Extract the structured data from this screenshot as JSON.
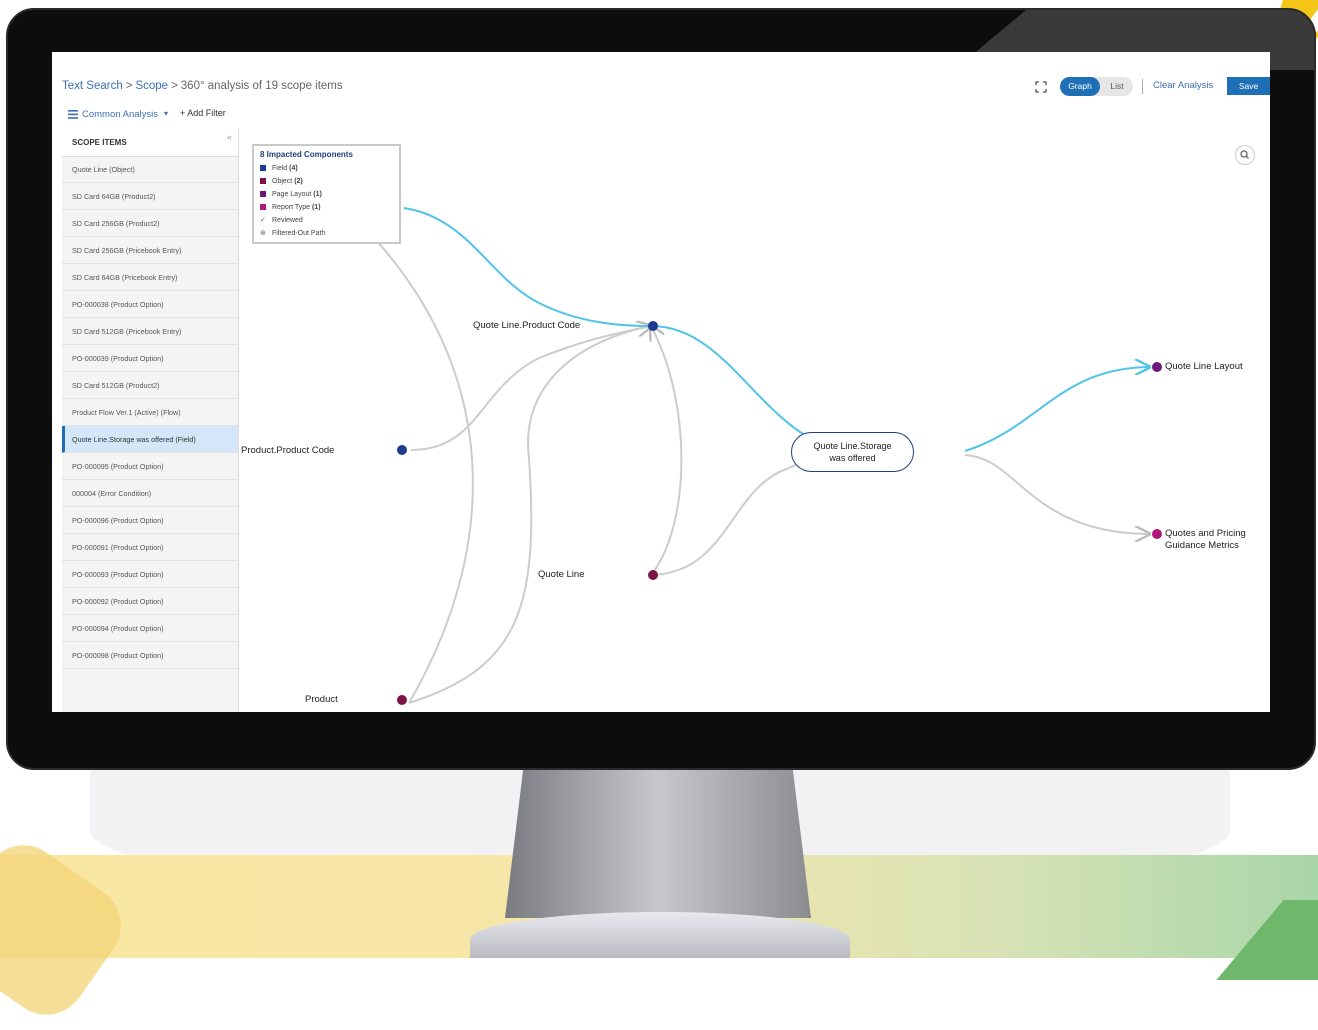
{
  "header": {
    "breadcrumb": [
      "Text Search",
      "Scope",
      "360° analysis of 19 scope items"
    ],
    "breadcrumb_sep": ">",
    "view_toggle": {
      "graph": "Graph",
      "list": "List",
      "selected": "Graph"
    },
    "clear_label": "Clear Analysis",
    "save_label": "Save"
  },
  "toolbar": {
    "analysis_label": "Common Analysis",
    "add_filter_label": "+ Add Filter",
    "collapse_glyph": "«"
  },
  "sidebar": {
    "title": "SCOPE ITEMS",
    "items": [
      {
        "label": "Quote Line (Object)"
      },
      {
        "label": "SD Card 64GB (Product2)"
      },
      {
        "label": "SD Card 256GB (Product2)"
      },
      {
        "label": "SD Card 256GB (Pricebook Entry)"
      },
      {
        "label": "SD Card 64GB (Pricebook Entry)"
      },
      {
        "label": "PO-000038 (Product Option)"
      },
      {
        "label": "SD Card 512GB (Pricebook Entry)"
      },
      {
        "label": "PO-000039 (Product Option)"
      },
      {
        "label": "SD Card 512GB (Product2)"
      },
      {
        "label": "Product Flow Ver.1 (Active) (Flow)"
      },
      {
        "label": "Quote Line.Storage was offered (Field)",
        "selected": true
      },
      {
        "label": "PO-000095 (Product Option)"
      },
      {
        "label": "000004 (Error Condition)"
      },
      {
        "label": "PO-000096 (Product Option)"
      },
      {
        "label": "PO-000091 (Product Option)"
      },
      {
        "label": "PO-000093 (Product Option)"
      },
      {
        "label": "PO-000092 (Product Option)"
      },
      {
        "label": "PO-000094 (Product Option)"
      },
      {
        "label": "PO-000098 (Product Option)"
      }
    ]
  },
  "legend": {
    "title": "8 Impacted Components",
    "entries": [
      {
        "label": "Field",
        "count": "(4)",
        "color": "#1f3a93"
      },
      {
        "label": "Object",
        "count": "(2)",
        "color": "#7b1346"
      },
      {
        "label": "Page Layout",
        "count": "(1)",
        "color": "#6a1b7a"
      },
      {
        "label": "Report Type",
        "count": "(1)",
        "color": "#b0177a"
      }
    ],
    "status": [
      {
        "label": "Reviewed",
        "glyph": "✓"
      },
      {
        "label": "Filtered-Out Path",
        "glyph": "⊕"
      }
    ]
  },
  "graph": {
    "nodes": {
      "product_code": "Quote Line.Product Code",
      "product_product_code": "Product.Product Code",
      "quote_line": "Quote Line",
      "product": "Product",
      "center_line1": "Quote Line.Storage",
      "center_line2": "was offered",
      "quote_line_layout": "Quote Line Layout",
      "report_line1": "Quotes and Pricing",
      "report_line2": "Guidance Metrics"
    },
    "colors": {
      "field": "#1f3a93",
      "object": "#7b1346",
      "page_layout": "#6a1b7a",
      "report_type": "#b0177a",
      "highlight_edge": "#4fc3e8",
      "edge": "#cccccc"
    }
  }
}
